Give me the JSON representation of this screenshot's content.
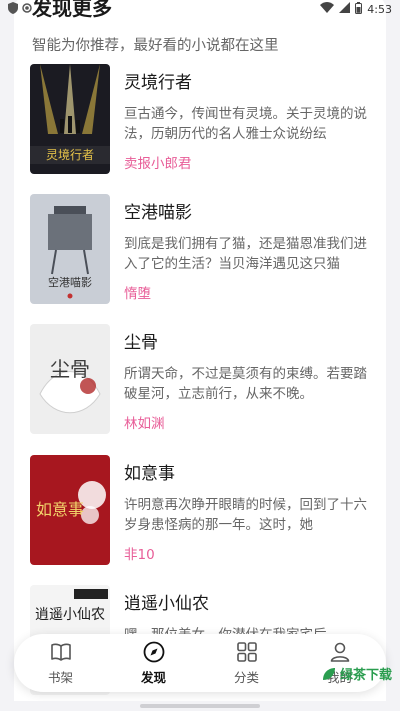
{
  "status_bar": {
    "time": "4:53",
    "icons": [
      "shield-icon",
      "record-icon",
      "wifi-icon",
      "signal-icon",
      "battery-icon"
    ]
  },
  "header": {
    "title": "发现更多",
    "subtitle": "智能为你推荐，最好看的小说都在这里"
  },
  "books": [
    {
      "title": "灵境行者",
      "desc": "亘古通今，传闻世有灵境。关于灵境的说法，历朝历代的名人雅士众说纷纭",
      "author": "卖报小郎君",
      "cover_text": "灵境行者",
      "cover_colors": [
        "#1b1b22",
        "#e6c34a"
      ]
    },
    {
      "title": "空港喵影",
      "desc": "到底是我们拥有了猫，还是猫恩准我们进入了它的生活？当贝海洋遇见这只猫",
      "author": "惰堕",
      "cover_text": "空港喵影",
      "cover_colors": [
        "#c9ced6",
        "#4a4f58"
      ]
    },
    {
      "title": "尘骨",
      "desc": "所谓天命，不过是莫须有的束缚。若要踏破星河，立志前行，从来不晚。",
      "author": "林如渊",
      "cover_text": "尘骨",
      "cover_colors": [
        "#eeeeee",
        "#3b3b3b"
      ]
    },
    {
      "title": "如意事",
      "desc": "许明意再次睁开眼睛的时候，回到了十六岁身患怪病的那一年。这时，她",
      "author": "非10",
      "cover_text": "如意事",
      "cover_colors": [
        "#a7171f",
        "#f2d36b"
      ]
    },
    {
      "title": "逍遥小仙农",
      "desc": "嘿，那位美女，你潜伏在我家宅后",
      "author": "",
      "cover_text": "逍遥小仙农",
      "cover_colors": [
        "#f4f4f4",
        "#1d1d1d"
      ]
    }
  ],
  "tabs": [
    {
      "label": "书架",
      "icon": "book-icon",
      "active": false
    },
    {
      "label": "发现",
      "icon": "compass-icon",
      "active": true
    },
    {
      "label": "分类",
      "icon": "grid-icon",
      "active": false
    },
    {
      "label": "我的",
      "icon": "user-icon",
      "active": false
    }
  ],
  "watermark": {
    "text": "绿茶下载"
  }
}
